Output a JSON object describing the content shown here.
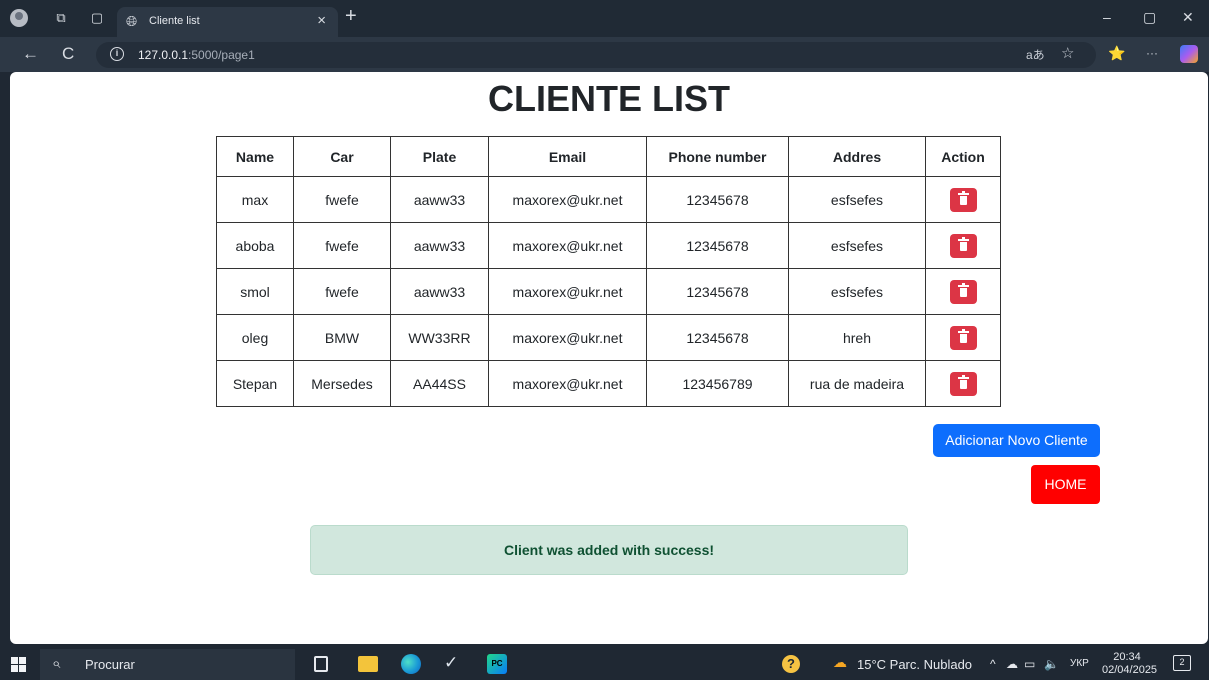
{
  "browser": {
    "tab_title": "Cliente list",
    "tab_close": "×",
    "new_tab": "+",
    "url_host": "127.0.0.1",
    "url_path": ":5000/page1",
    "read_aloud": "aあ",
    "favorite_icon": "☆",
    "collections_icon": "⭐",
    "more_icon": "···",
    "back_icon": "←",
    "refresh_icon": "C",
    "info_icon": "i",
    "window_controls": {
      "minimize": "–",
      "restore": "▢",
      "close": "✕"
    }
  },
  "page": {
    "title": "CLIENTE LIST",
    "table": {
      "headers": [
        "Name",
        "Car",
        "Plate",
        "Email",
        "Phone number",
        "Addres",
        "Action"
      ],
      "rows": [
        [
          "max",
          "fwefe",
          "aaww33",
          "maxorex@ukr.net",
          "12345678",
          "esfsefes"
        ],
        [
          "aboba",
          "fwefe",
          "aaww33",
          "maxorex@ukr.net",
          "12345678",
          "esfsefes"
        ],
        [
          "smol",
          "fwefe",
          "aaww33",
          "maxorex@ukr.net",
          "12345678",
          "esfsefes"
        ],
        [
          "oleg",
          "BMW",
          "WW33RR",
          "maxorex@ukr.net",
          "12345678",
          "hreh"
        ],
        [
          "Stepan",
          "Mersedes",
          "AA44SS",
          "maxorex@ukr.net",
          "123456789",
          "rua de madeira"
        ]
      ]
    },
    "add_button": "Adicionar Novo Cliente",
    "home_button": "HOME",
    "alert": "Client was added with success!"
  },
  "taskbar": {
    "search_placeholder": "Procurar",
    "weather": "15°C  Parc. Nublado",
    "tray_arrow": "^",
    "language": "УКР",
    "time": "20:34",
    "date": "02/04/2025",
    "notifications": "2",
    "help_icon": "?",
    "steam_icon": "✓",
    "pycharm_label": "PC",
    "weather_icon": "☁",
    "cloud_icon": "☁",
    "battery_icon": "▭",
    "volume_icon": "🔈"
  },
  "colors": {
    "primary": "#0d6efd",
    "danger": "#dc3545",
    "home": "#ff0000",
    "success_bg": "#d1e7dd",
    "success_text": "#0f5132"
  }
}
